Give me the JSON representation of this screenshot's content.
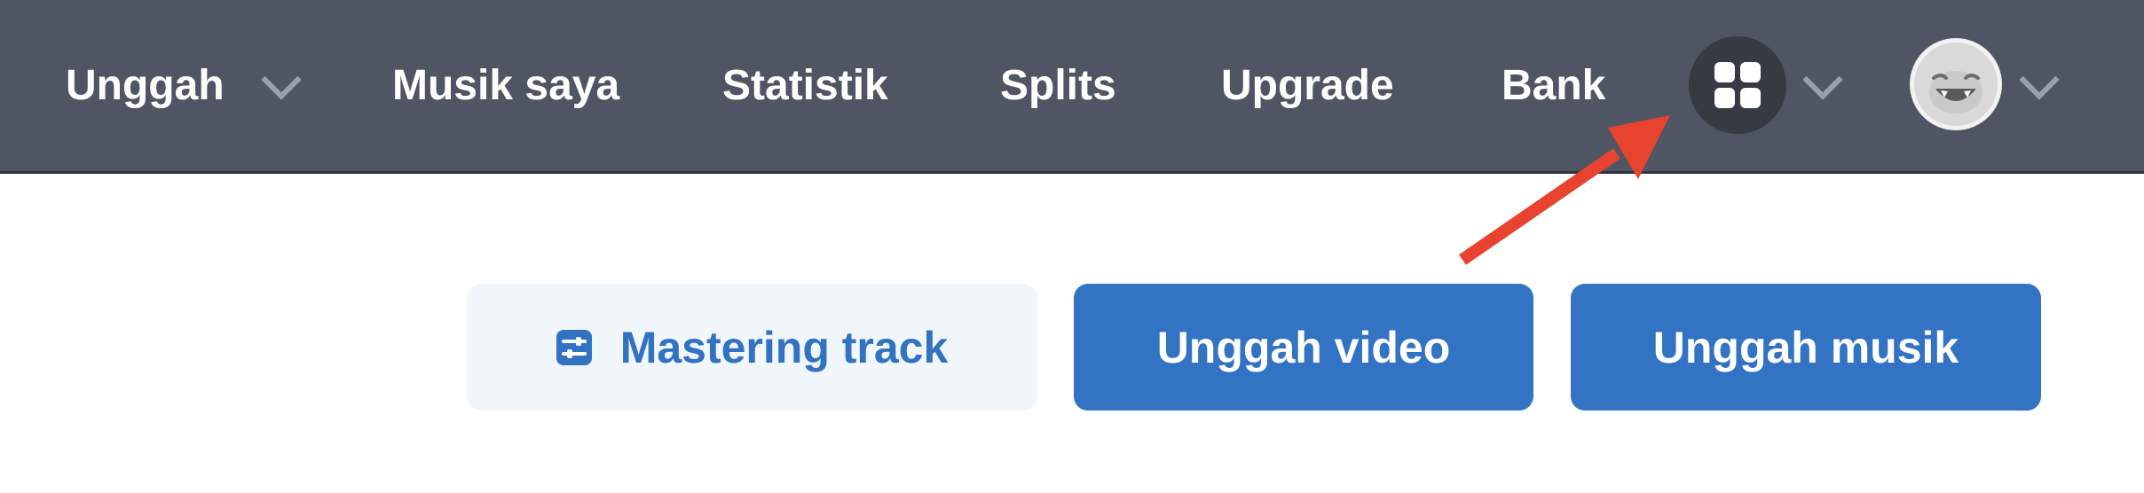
{
  "nav": {
    "upload_label": "Unggah",
    "items": [
      {
        "label": "Musik saya"
      },
      {
        "label": "Statistik"
      },
      {
        "label": "Splits"
      },
      {
        "label": "Upgrade"
      },
      {
        "label": "Bank"
      }
    ],
    "apps_icon": "grid-icon",
    "avatar_icon": "smiley-avatar-icon"
  },
  "actions": {
    "mastering_label": "Mastering track",
    "upload_video_label": "Unggah video",
    "upload_music_label": "Unggah musik"
  },
  "annotation": {
    "arrow_color": "#e8432e"
  },
  "colors": {
    "topbar": "#4f5563",
    "primary": "#3273c3",
    "light_button_bg": "#f1f6fb"
  }
}
